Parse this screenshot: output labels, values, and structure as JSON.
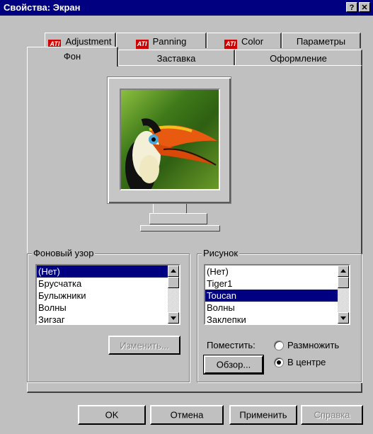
{
  "window": {
    "title": "Свойства: Экран",
    "help_button": "?",
    "close_button": "✕"
  },
  "tabs_row1": [
    {
      "label": "Adjustment",
      "icon": "ati-icon"
    },
    {
      "label": "Panning",
      "icon": "ati-icon"
    },
    {
      "label": "Color",
      "icon": "ati-icon"
    },
    {
      "label": "Параметры"
    }
  ],
  "tabs_row2": [
    {
      "label": "Фон",
      "active": true
    },
    {
      "label": "Заставка"
    },
    {
      "label": "Оформление"
    }
  ],
  "ati_logo_text": "ATI",
  "pattern_group": {
    "title": "Фоновый узор",
    "items": [
      "(Нет)",
      "Брусчатка",
      "Булыжники",
      "Волны",
      "Зигзаг"
    ],
    "selected_index": 0,
    "edit_button": "Изменить..."
  },
  "wallpaper_group": {
    "title": "Рисунок",
    "items": [
      "(Нет)",
      "Tiger1",
      "Toucan",
      "Волны",
      "Заклепки"
    ],
    "selected_index": 2,
    "display_label": "Поместить:",
    "options": [
      {
        "label": "Размножить",
        "checked": false
      },
      {
        "label": "В центре",
        "checked": true
      }
    ],
    "browse_button": "Обзор..."
  },
  "footer": {
    "ok": "OK",
    "cancel": "Отмена",
    "apply": "Применить",
    "help": "Справка"
  }
}
